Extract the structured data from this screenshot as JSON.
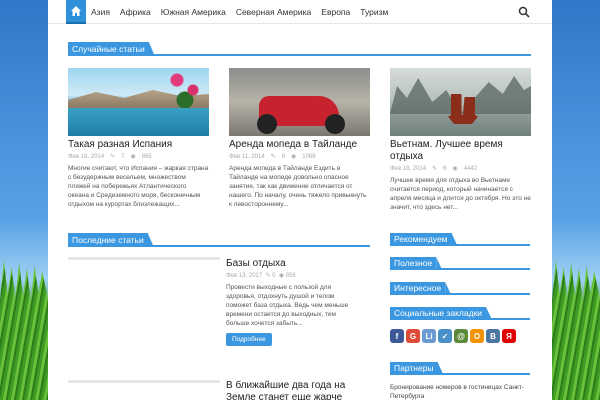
{
  "nav": {
    "items": [
      "Азия",
      "Африка",
      "Южная Америка",
      "Северная Америка",
      "Европа",
      "Туризм"
    ]
  },
  "random": {
    "heading": "Случайные статьи",
    "cards": [
      {
        "title": "Такая разная Испания",
        "date": "Фев 18, 2014",
        "comments": "7",
        "views": "865",
        "excerpt": "Многие считают, что Испания – жаркая страна с безудержным весельем, множеством пляжей на побережьях Атлантического океана и Средиземного моря, бесконечным отдыхом на курортах близлежащих..."
      },
      {
        "title": "Аренда мопеда в Тайланде",
        "date": "Фев 11, 2014",
        "comments": "8",
        "views": "1068",
        "excerpt": "Аренда мопеда в Тайланде Ездить в Тайланде на мопеде довольно опасное занятие, так как движение отличается от нашего. По началу, очень тяжело привыкнуть к левостороннему..."
      },
      {
        "title": "Вьетнам. Лучшее время отдыха",
        "date": "Фев 18, 2014",
        "comments": "6",
        "views": "4442",
        "excerpt": "Лучшее время для отдыха во Вьетнаме считается период, который начинается с апреля месяца и длится до октября. Но это не значит, что здесь нет..."
      }
    ]
  },
  "latest": {
    "heading": "Последние статьи",
    "posts": [
      {
        "title": "Базы отдыха",
        "date": "Фев 13, 2017",
        "comments": "0",
        "views": "856",
        "excerpt": "Провести выходные с пользой для здоровья, отдохнуть душой и телом поможет база отдыха. Ведь чем меньше времени остается до выходных, тем больше хочется забыть...",
        "button": "Подробнее"
      },
      {
        "title": "В ближайшие два года на Земле станет еще жарче"
      }
    ]
  },
  "sidebar": {
    "recommend": "Рекомендуем",
    "useful": "Полезное",
    "interesting": "Интересное",
    "social": "Социальные закладки",
    "partners": "Партнеры",
    "partners_text": "Бронирование номеров в гостиницах Санкт-Петербурга",
    "social_icons": [
      "f",
      "G",
      "Li",
      "✓",
      "@",
      "О",
      "В",
      "Я"
    ],
    "social_colors": [
      "#3b5998",
      "#dd4b39",
      "#6b9bd1",
      "#4a90c8",
      "#5d8a3a",
      "#f39200",
      "#4c75a3",
      "#e00000"
    ]
  },
  "colors": {
    "accent": "#3b98e0"
  }
}
